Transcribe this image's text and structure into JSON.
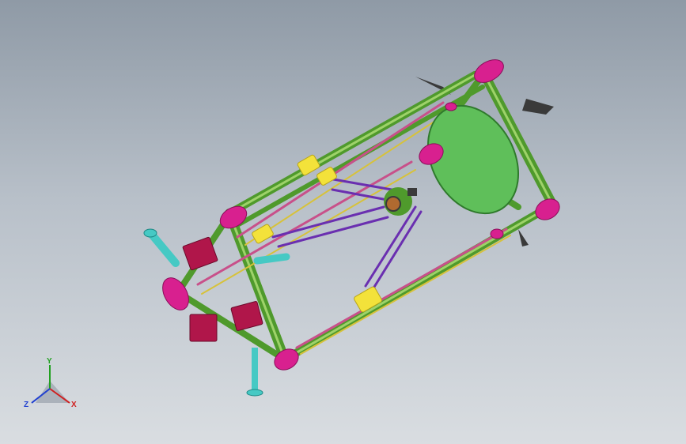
{
  "viewport": {
    "background_top": "#8f9aa6",
    "background_bottom": "#d9dde1"
  },
  "model": {
    "frame_color": "#4f9a2c",
    "frame_highlight": "#9ed26a",
    "bracket_color": "#d8208f",
    "rod_color": "#c8508a",
    "arm_color": "#6a2fb0",
    "carriage_color": "#f3e23a",
    "motor_color": "#b0164a",
    "bed_color": "#5fbf5a",
    "spool_color": "#46c9c4",
    "fan_color": "#3a3a3a"
  },
  "triad": {
    "y_label": "Y",
    "x_label": "X",
    "z_label": "Z",
    "x_color": "#d02020",
    "y_color": "#20a020",
    "z_color": "#2040d0"
  }
}
